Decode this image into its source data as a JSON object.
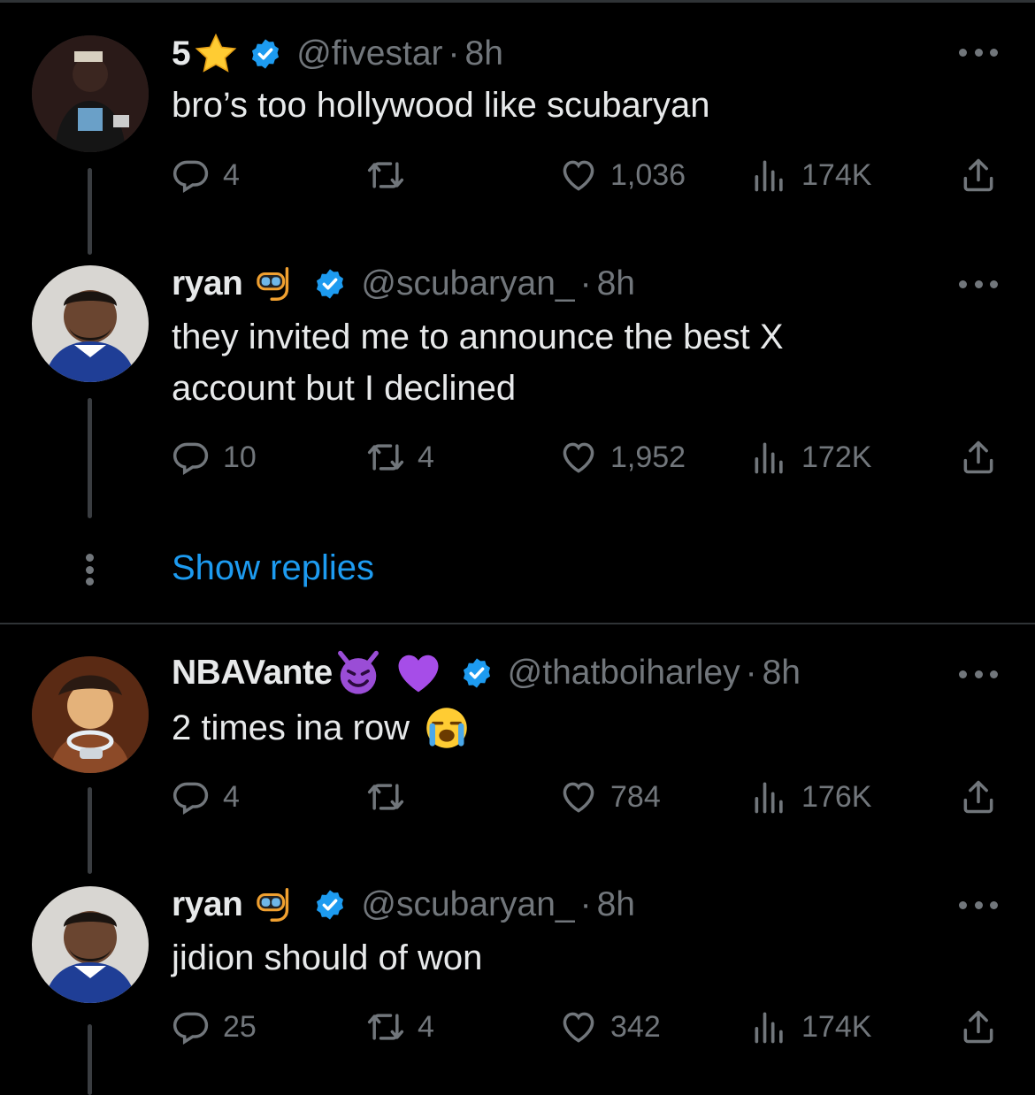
{
  "colors": {
    "background": "#000000",
    "text": "#e7e9ea",
    "muted": "#71767b",
    "accent": "#1d9bf0",
    "verified": "#1d9bf0",
    "separator": "#2f3336"
  },
  "tweets": [
    {
      "name": "5",
      "name_emojis": [
        "star-emoji"
      ],
      "handle": "@fivestar",
      "dot": "·",
      "time": "8h",
      "text": "bro’s too hollywood like scubaryan",
      "replies": "4",
      "retweets": "",
      "likes": "1,036",
      "views": "174K"
    },
    {
      "name": "ryan",
      "name_emojis": [
        "diving-mask-emoji"
      ],
      "handle": "@scubaryan_",
      "dot": "·",
      "time": "8h",
      "text": "they invited me to announce the best X\naccount but I declined",
      "replies": "10",
      "retweets": "4",
      "likes": "1,952",
      "views": "172K"
    },
    {
      "name": "NBAVante",
      "name_emojis": [
        "smiling-devil-emoji",
        "purple-heart-emoji"
      ],
      "handle": "@thatboiharley",
      "dot": "·",
      "time": "8h",
      "text": "2 times ina row",
      "text_emoji": "crying-face-emoji",
      "replies": "4",
      "retweets": "",
      "likes": "784",
      "views": "176K"
    },
    {
      "name": "ryan",
      "name_emojis": [
        "diving-mask-emoji"
      ],
      "handle": "@scubaryan_",
      "dot": "·",
      "time": "8h",
      "text": "jidion should of won",
      "replies": "25",
      "retweets": "4",
      "likes": "342",
      "views": "174K"
    }
  ],
  "show_replies_label": "Show replies",
  "icons": [
    "reply-icon",
    "retweet-icon",
    "like-icon",
    "views-icon",
    "share-icon",
    "more-icon",
    "verified-badge-icon"
  ]
}
